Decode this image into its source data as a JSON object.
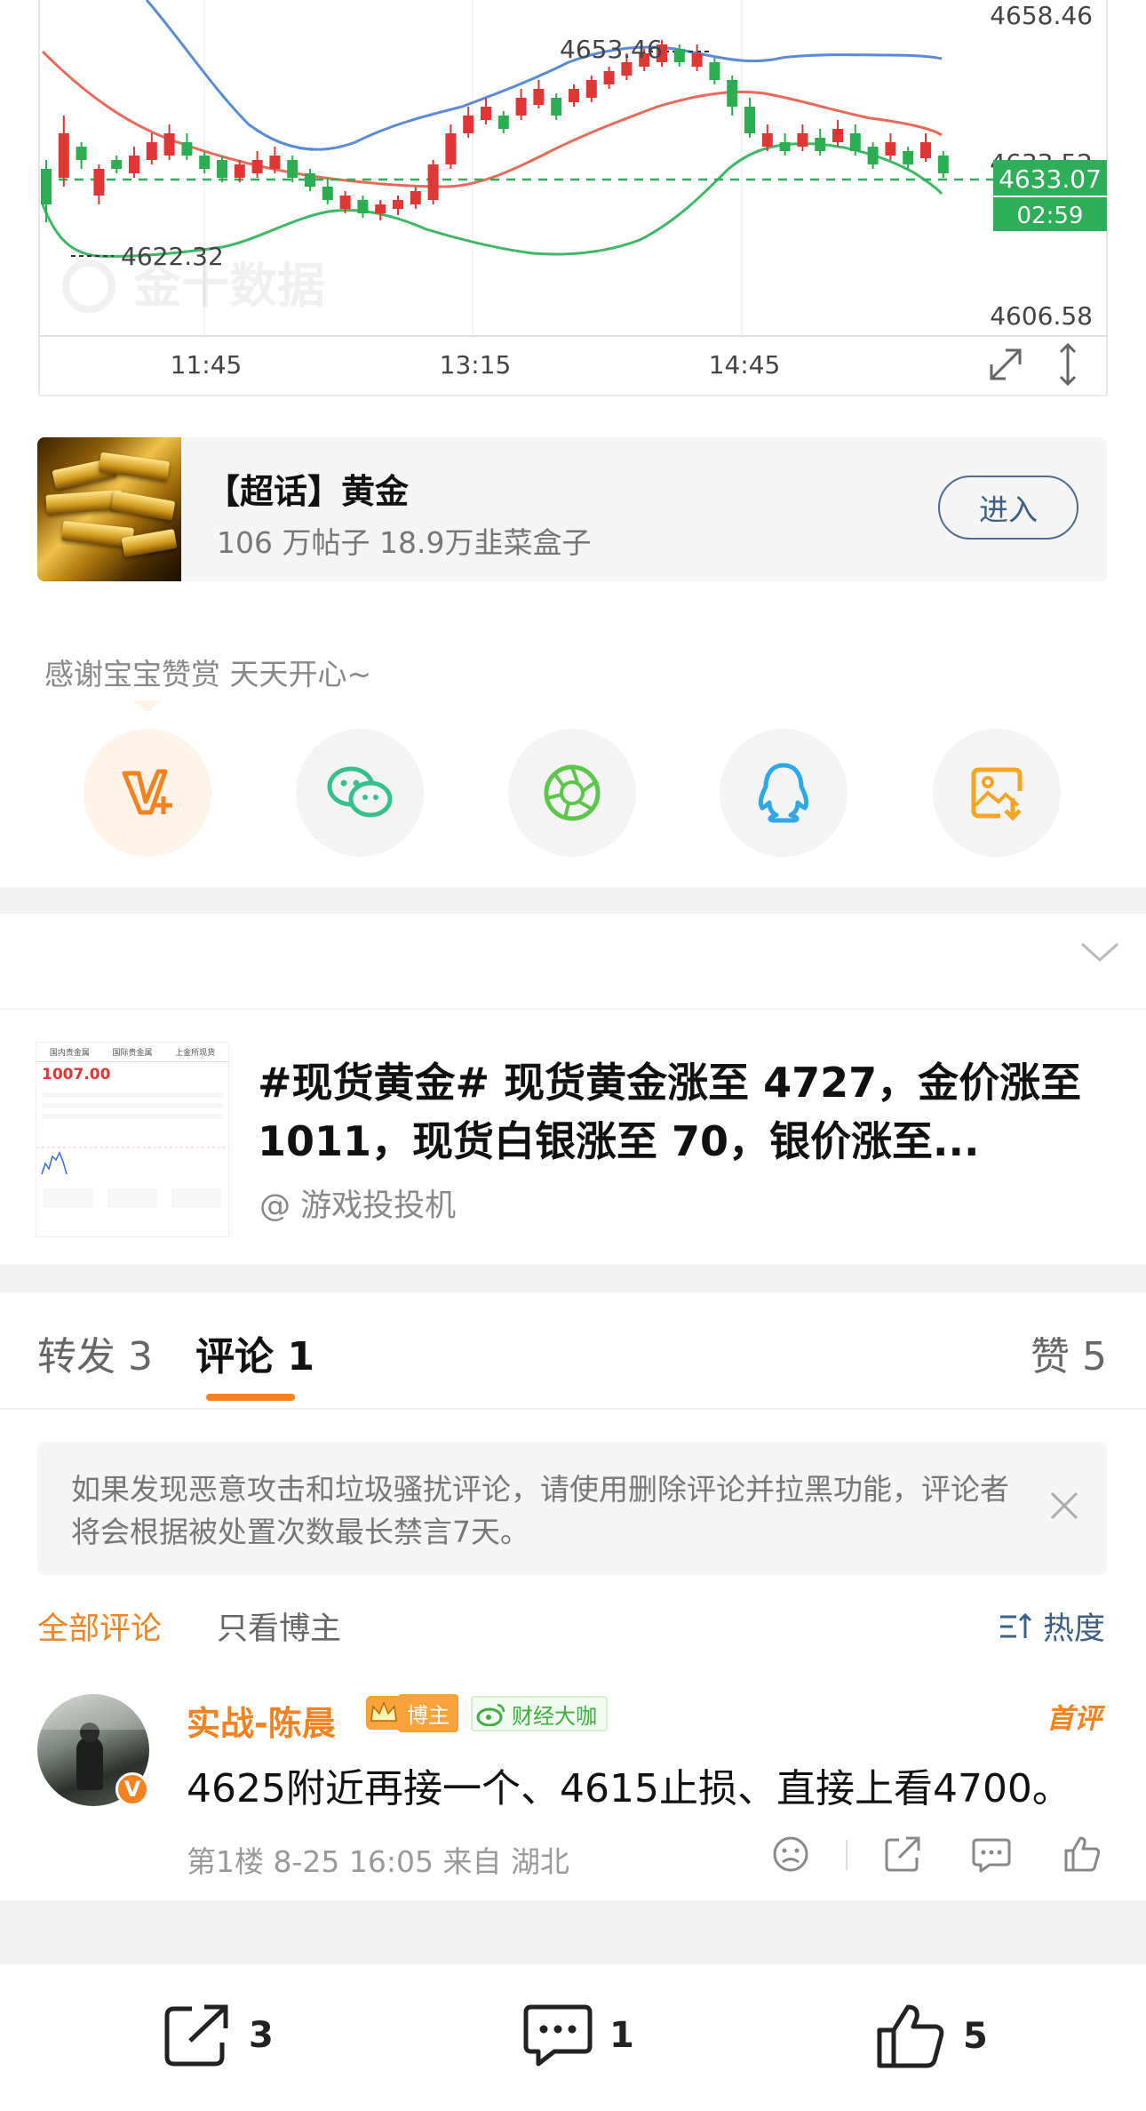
{
  "chart": {
    "price_labels": {
      "high": "4658.46",
      "peak": "4653.46",
      "mid_hidden": "4633.52",
      "current": "4633.07",
      "low": "4606.58",
      "trough": "4622.32"
    },
    "countdown": "02:59",
    "time_labels": [
      "11:45",
      "13:15",
      "14:45"
    ],
    "watermark": "金十数据",
    "colors": {
      "up": "#e03636",
      "down": "#2dad51",
      "upper_band": "#5b8bd6",
      "ma": "#e96a5a",
      "lower_band": "#3db865",
      "price_tag": "#2fae5a"
    }
  },
  "topic": {
    "title": "【超话】黄金",
    "stats": "106 万帖子 18.9万韭菜盒子",
    "enter_label": "进入"
  },
  "reward": {
    "text": "感谢宝宝赞赏 天天开心~"
  },
  "share": {
    "items": [
      {
        "icon": "weibo-reward-icon",
        "color": "#f58220"
      },
      {
        "icon": "wechat-icon",
        "color": "#36c08b"
      },
      {
        "icon": "moments-icon",
        "color": "#5cc64a"
      },
      {
        "icon": "qq-icon",
        "color": "#2ea7e8"
      },
      {
        "icon": "save-image-icon",
        "color": "#f4a623"
      }
    ]
  },
  "repost": {
    "text": "#现货黄金# 现货黄金涨至 4727，金价涨至 1011，现货白银涨至 70，银价涨至...",
    "author": "@ 游戏投投机",
    "thumb": {
      "tabs": [
        "国内贵金属",
        "国际贵金属",
        "上金所现货"
      ],
      "price": "1007.00"
    }
  },
  "tabs": {
    "repost": "转发 3",
    "comment": "评论 1",
    "like": "赞 5"
  },
  "notice": {
    "text": "如果发现恶意攻击和垃圾骚扰评论，请使用删除评论并拉黑功能，评论者将会根据被处置次数最长禁言7天。"
  },
  "filter": {
    "all": "全部评论",
    "author_only": "只看博主",
    "sort": "热度"
  },
  "comment": {
    "name": "实战-陈晨",
    "badge_blogger": "博主",
    "badge_finance": "财经大咖",
    "first_tag": "首评",
    "text": "4625附近再接一个、4615止损、直接上看4700。",
    "meta": "第1楼 8-25 16:05 来自 湖北"
  },
  "bottom_bar": {
    "repost_count": "3",
    "comment_count": "1",
    "like_count": "5"
  }
}
